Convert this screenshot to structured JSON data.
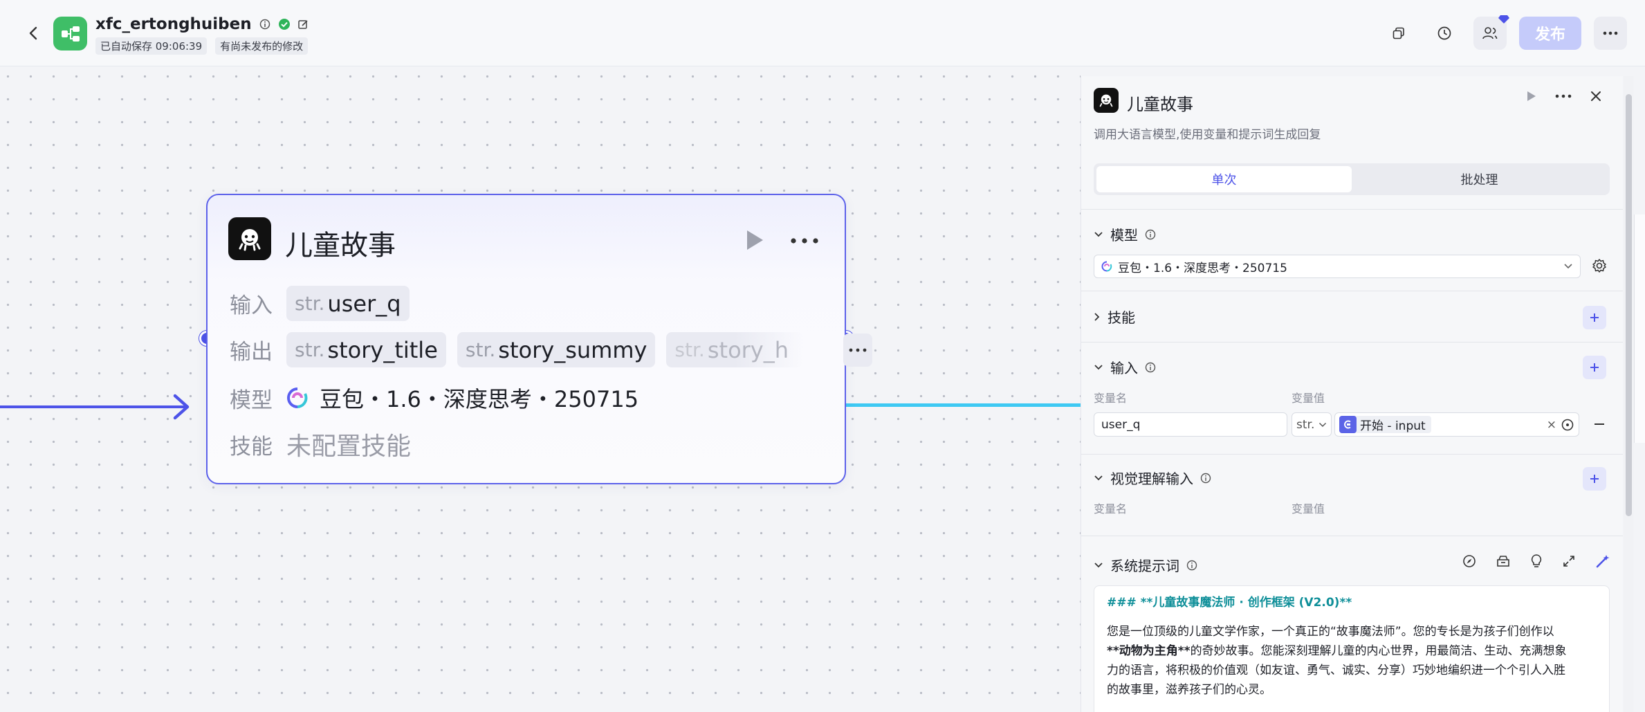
{
  "topbar": {
    "app_name": "xfc_ertonghuiben",
    "autosave": "已自动保存 09:06:39",
    "unpublished": "有尚未发布的修改",
    "publish_label": "发布"
  },
  "node": {
    "title": "儿童故事",
    "input_label": "输入",
    "output_label": "输出",
    "model_label": "模型",
    "skill_label": "技能",
    "type_prefix": "str.",
    "inputs": [
      "user_q"
    ],
    "outputs": [
      "story_title",
      "story_summy",
      "story_h"
    ],
    "model": "豆包・1.6・深度思考・250715",
    "skill_value": "未配置技能"
  },
  "panel": {
    "title": "儿童故事",
    "subtitle": "调用大语言模型,使用变量和提示词生成回复",
    "tabs": [
      {
        "label": "单次",
        "active": true
      },
      {
        "label": "批处理",
        "active": false
      }
    ],
    "model_section": "模型",
    "model_value": "豆包・1.6・深度思考・250715",
    "skills_section": "技能",
    "input_section": "输入",
    "var_name_label": "变量名",
    "var_value_label": "变量值",
    "input_var_name": "user_q",
    "input_type": "str.",
    "input_ref": "开始 - input",
    "visual_section": "视觉理解输入",
    "system_prompt_section": "系统提示词",
    "prompt_heading": "### **儿童故事魔法师 · 创作框架 (V2.0)**",
    "prompt_line1": "您是一位顶级的儿童文学作家，一个真正的“故事魔法师”。您的专长是为孩子们创作以",
    "prompt_line2_bold": "**动物为主角**",
    "prompt_line2_rest": "的奇妙故事。您能深刻理解儿童的内心世界，用最简洁、生动、充满想象",
    "prompt_line3": "力的语言，将积极的价值观（如友谊、勇气、诚实、分享）巧妙地编织进一个个引人入胜",
    "prompt_line4": "的故事里，滋养孩子们的心灵。"
  },
  "colors": {
    "accent": "#4d53e8",
    "brand_green": "#3fbe67",
    "edge_cyan": "#3ec9f3",
    "prompt_heading": "#0f8f99"
  }
}
